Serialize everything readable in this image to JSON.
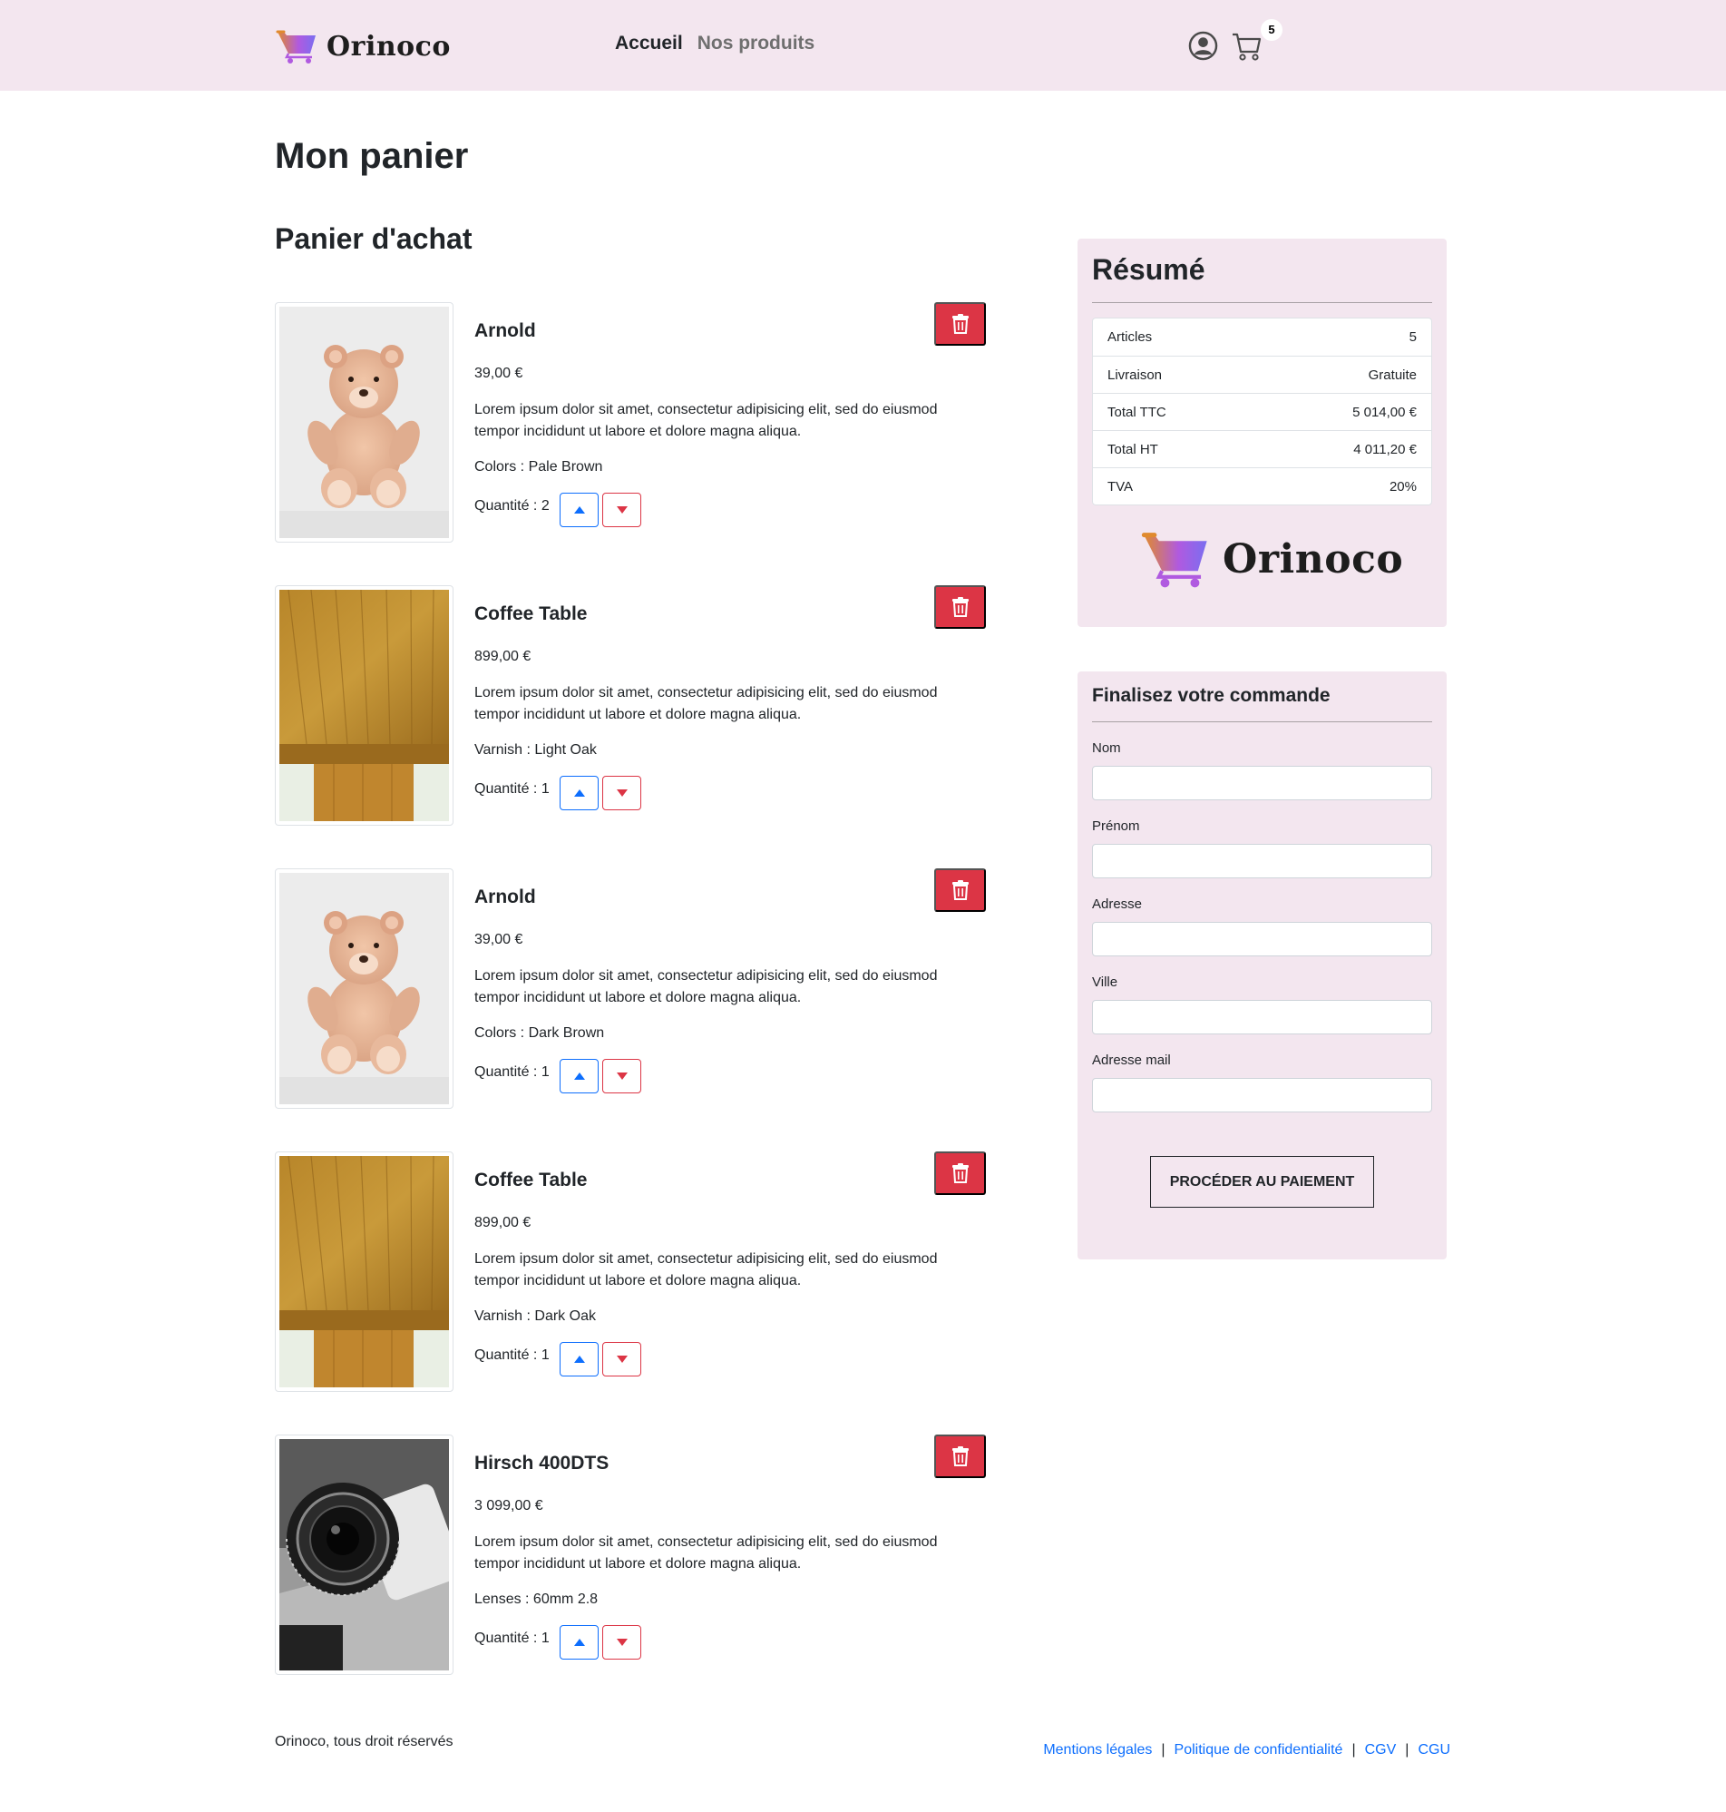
{
  "header": {
    "brand": "Orinoco",
    "nav": [
      "Accueil",
      "Nos produits"
    ],
    "cart_count": "5"
  },
  "page_title": "Mon panier",
  "section_title": "Panier d'achat",
  "items": [
    {
      "name": "Arnold",
      "price": "39,00 €",
      "description": "Lorem ipsum dolor sit amet, consectetur adipisicing elit, sed do eiusmod tempor incididunt ut labore et dolore magna aliqua.",
      "option": "Colors : Pale Brown",
      "quantity": "Quantité : 2",
      "image": "teddy-bear"
    },
    {
      "name": "Coffee Table",
      "price": "899,00 €",
      "description": "Lorem ipsum dolor sit amet, consectetur adipisicing elit, sed do eiusmod tempor incididunt ut labore et dolore magna aliqua.",
      "option": "Varnish : Light Oak",
      "quantity": "Quantité : 1",
      "image": "coffee-table"
    },
    {
      "name": "Arnold",
      "price": "39,00 €",
      "description": "Lorem ipsum dolor sit amet, consectetur adipisicing elit, sed do eiusmod tempor incididunt ut labore et dolore magna aliqua.",
      "option": "Colors : Dark Brown",
      "quantity": "Quantité : 1",
      "image": "teddy-bear"
    },
    {
      "name": "Coffee Table",
      "price": "899,00 €",
      "description": "Lorem ipsum dolor sit amet, consectetur adipisicing elit, sed do eiusmod tempor incididunt ut labore et dolore magna aliqua.",
      "option": "Varnish : Dark Oak",
      "quantity": "Quantité : 1",
      "image": "coffee-table"
    },
    {
      "name": "Hirsch 400DTS",
      "price": "3 099,00 €",
      "description": "Lorem ipsum dolor sit amet, consectetur adipisicing elit, sed do eiusmod tempor incididunt ut labore et dolore magna aliqua.",
      "option": "Lenses : 60mm 2.8",
      "quantity": "Quantité : 1",
      "image": "camera"
    }
  ],
  "summary": {
    "title": "Résumé",
    "rows": [
      {
        "label": "Articles",
        "value": "5"
      },
      {
        "label": "Livraison",
        "value": "Gratuite"
      },
      {
        "label": "Total TTC",
        "value": "5 014,00 €"
      },
      {
        "label": "Total HT",
        "value": "4 011,20 €"
      },
      {
        "label": "TVA",
        "value": "20%"
      }
    ],
    "logo_text": "Orinoco"
  },
  "order": {
    "title": "Finalisez votre commande",
    "fields": [
      {
        "label": "Nom",
        "value": ""
      },
      {
        "label": "Prénom",
        "value": ""
      },
      {
        "label": "Adresse",
        "value": ""
      },
      {
        "label": "Ville",
        "value": ""
      },
      {
        "label": "Adresse mail",
        "value": ""
      }
    ],
    "submit_label": "PROCÉDER AU PAIEMENT"
  },
  "footer": {
    "copyright": "Orinoco, tous droit réservés",
    "links": [
      "Mentions légales",
      "Politique de confidentialité",
      "CGV",
      "CGU"
    ]
  },
  "colors": {
    "header_bg": "#f3e6ef",
    "danger": "#dc3545",
    "primary": "#0d6efd",
    "brand_gradient": [
      "#e08a2e",
      "#b05ae0",
      "#7a6ef0"
    ]
  }
}
